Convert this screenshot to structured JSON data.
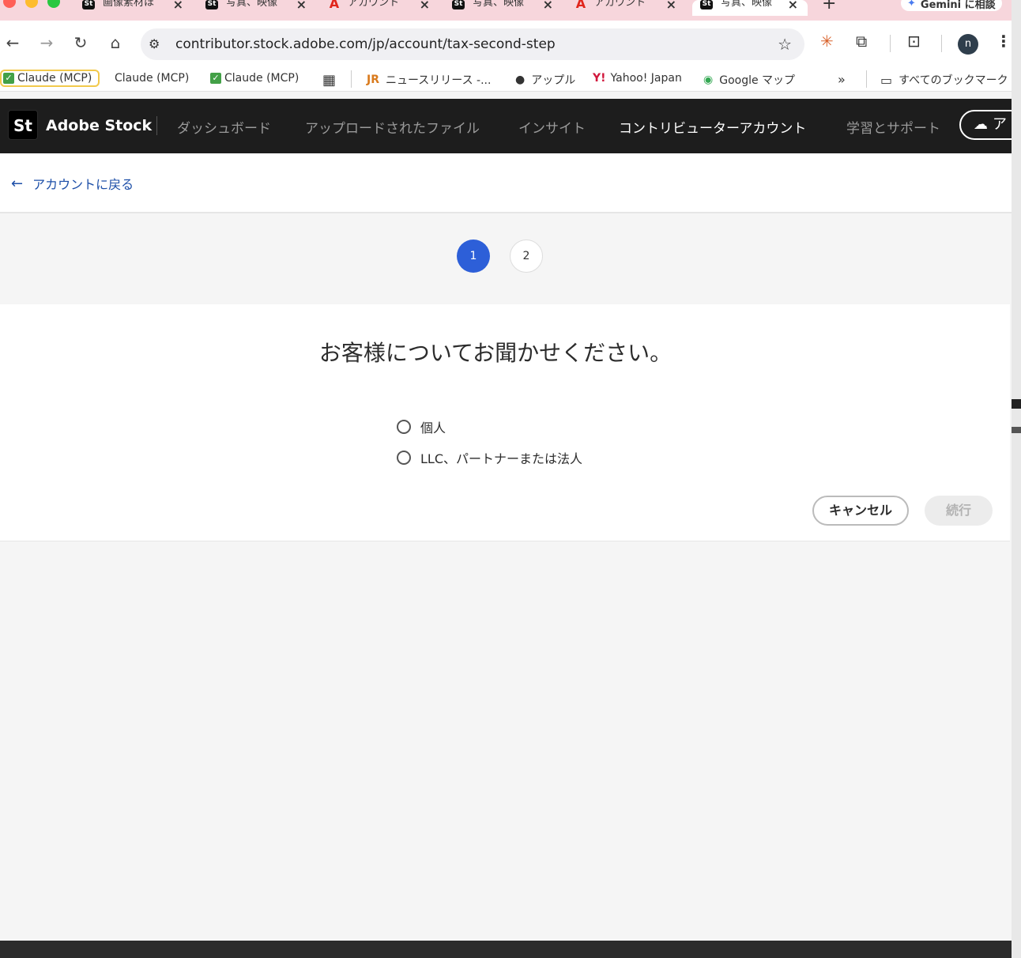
{
  "browser": {
    "tabs": [
      {
        "favicon": "St",
        "title": "画像素材ほ"
      },
      {
        "favicon": "St",
        "title": "写真、映像"
      },
      {
        "favicon": "A",
        "title": "アカウント"
      },
      {
        "favicon": "St",
        "title": "写真、映像"
      },
      {
        "favicon": "A",
        "title": "アカウント"
      },
      {
        "favicon": "St",
        "title": "写真、映像"
      }
    ],
    "gemini_label": "Gemini に相談",
    "url": "contributor.stock.adobe.com/jp/account/tax-second-step",
    "avatar_letter": "n",
    "bookmarks": [
      "Claude (MCP)",
      "Claude (MCP)",
      "Claude (MCP)",
      "ニュースリリース -...",
      "アップル",
      "Yahoo! Japan",
      "Google マップ"
    ],
    "bookmarks_overflow": "»",
    "all_bookmarks": "すべてのブックマーク"
  },
  "header": {
    "logo": "St",
    "brand": "Adobe Stock",
    "nav": [
      "ダッシュボード",
      "アップロードされたファイル",
      "インサイト",
      "コントリビューターアカウント",
      "学習とサポート"
    ],
    "upload_partial": "ア"
  },
  "back_link": "アカウントに戻る",
  "steps": [
    "1",
    "2"
  ],
  "form": {
    "question": "お客様についてお聞かせください。",
    "options": [
      "個人",
      "LLC、パートナーまたは法人"
    ],
    "cancel": "キャンセル",
    "continue": "続行"
  },
  "colors": {
    "accent": "#2d5fd8",
    "link": "#1d4fa8",
    "header_bg": "#1d1d1d"
  }
}
